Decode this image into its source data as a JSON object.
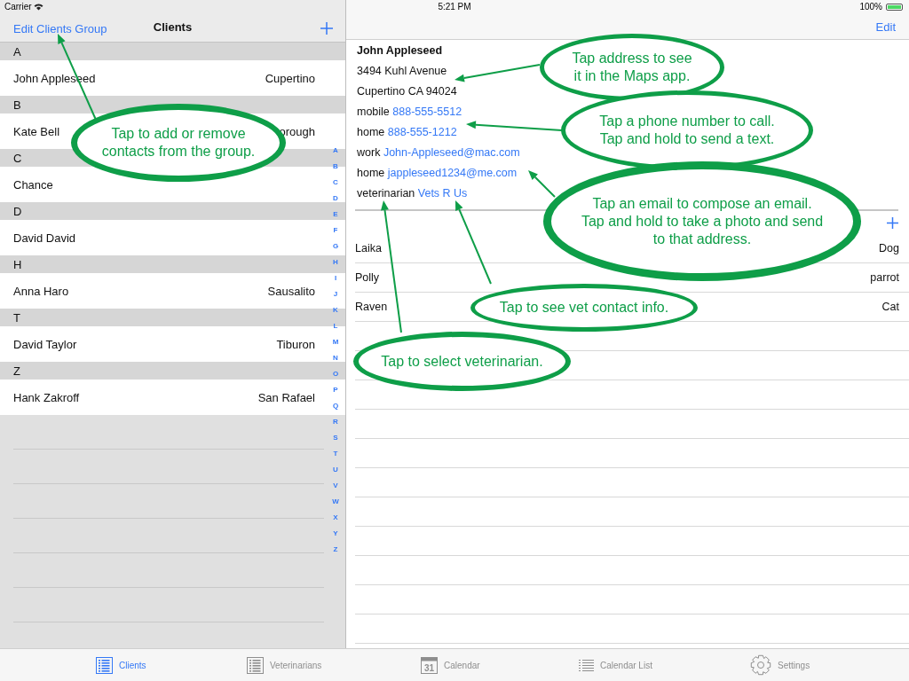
{
  "status_bar": {
    "carrier": "Carrier",
    "time": "5:21 PM",
    "battery": "100%"
  },
  "clients_pane": {
    "edit_button": "Edit Clients Group",
    "title": "Clients",
    "sections": [
      {
        "header": "A",
        "rows": [
          {
            "name": "John Appleseed",
            "city": "Cupertino"
          }
        ]
      },
      {
        "header": "B",
        "rows": [
          {
            "name": "Kate Bell",
            "city": "orough"
          }
        ]
      },
      {
        "header": "C",
        "rows": [
          {
            "name": "Chance"
          }
        ]
      },
      {
        "header": "D",
        "rows": [
          {
            "name": "David David"
          }
        ]
      },
      {
        "header": "H",
        "rows": [
          {
            "name": "Anna Haro",
            "city": "Sausalito"
          }
        ]
      },
      {
        "header": "T",
        "rows": [
          {
            "name": "David Taylor",
            "city": "Tiburon"
          }
        ]
      },
      {
        "header": "Z",
        "rows": [
          {
            "name": "Hank Zakroff",
            "city": "San Rafael"
          }
        ]
      }
    ],
    "index_letters": [
      "A",
      "B",
      "C",
      "D",
      "E",
      "F",
      "G",
      "H",
      "I",
      "J",
      "K",
      "L",
      "M",
      "N",
      "O",
      "P",
      "Q",
      "R",
      "S",
      "T",
      "U",
      "V",
      "W",
      "X",
      "Y",
      "Z"
    ]
  },
  "detail_pane": {
    "edit_button": "Edit",
    "name": "John Appleseed",
    "address": [
      "3494 Kuhl Avenue",
      "Cupertino CA 94024"
    ],
    "contacts": [
      {
        "label": "mobile",
        "value": "888-555-5512"
      },
      {
        "label": "home",
        "value": "888-555-1212"
      },
      {
        "label": "work",
        "value": "John-Appleseed@mac.com"
      },
      {
        "label": "home",
        "value": "jappleseed1234@me.com"
      },
      {
        "label": "veterinarian",
        "value": "Vets R Us"
      }
    ],
    "pets": [
      {
        "name": "Laika",
        "type": "Dog"
      },
      {
        "name": "Polly",
        "type": "parrot"
      },
      {
        "name": "Raven",
        "type": "Cat"
      }
    ]
  },
  "callouts": [
    {
      "lines": [
        "Tap to add or remove",
        "contacts from the group."
      ]
    },
    {
      "lines": [
        "Tap address to see",
        "it in the Maps app."
      ]
    },
    {
      "lines": [
        "Tap a phone number to call.",
        "Tap and hold to send a text."
      ]
    },
    {
      "lines": [
        "Tap an email to compose an email.",
        "Tap and hold to take a photo and send",
        "to that address."
      ]
    },
    {
      "lines": [
        "Tap to see vet contact info."
      ]
    },
    {
      "lines": [
        "Tap to select veterinarian."
      ]
    }
  ],
  "tab_bar": [
    {
      "label": "Clients",
      "kind": "boxed-list",
      "selected": true
    },
    {
      "label": "Veterinarians",
      "kind": "boxed-list",
      "selected": false
    },
    {
      "label": "Calendar",
      "kind": "calendar",
      "icon_text": "31",
      "selected": false
    },
    {
      "label": "Calendar List",
      "kind": "list",
      "selected": false
    },
    {
      "label": "Settings",
      "kind": "gear",
      "selected": false
    }
  ]
}
